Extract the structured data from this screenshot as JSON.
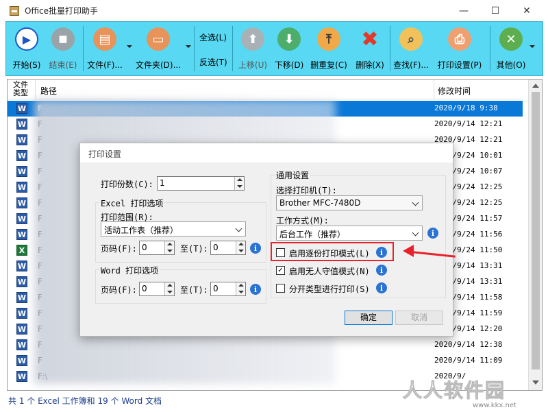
{
  "window": {
    "title": "Office批量打印助手",
    "minimize": "—",
    "maximize": "☐",
    "close": "✕"
  },
  "toolbar": {
    "start": "开始(S)",
    "end": "结束(E)",
    "file": "文件(F)...",
    "folder": "文件夹(D)...",
    "select_all": "全选(L)",
    "invert": "反选(T)",
    "move_up": "上移(U)",
    "move_down": "下移(D)",
    "dedupe": "删重复(C)",
    "delete": "删除(X)",
    "find": "查找(F)...",
    "print_settings": "打印设置(P)",
    "other": "其他(O)"
  },
  "list": {
    "col_type": "文件类型",
    "col_path": "路径",
    "col_time": "修改时间",
    "rows": [
      {
        "type": "word",
        "path": "F",
        "time": "2020/9/18  9:38",
        "selected": true
      },
      {
        "type": "word",
        "path": "F",
        "time": "2020/9/14 12:21"
      },
      {
        "type": "word",
        "path": "F",
        "time": "2020/9/14 12:21"
      },
      {
        "type": "word",
        "path": "F",
        "time": "2020/9/24 10:01"
      },
      {
        "type": "word",
        "path": "F",
        "time": "2020/9/24 10:07"
      },
      {
        "type": "word",
        "path": "F",
        "time": "2020/9/24 12:25"
      },
      {
        "type": "word",
        "path": "F",
        "time": "2020/9/24 12:25"
      },
      {
        "type": "word",
        "path": "F",
        "time": "2020/9/24 11:57"
      },
      {
        "type": "word",
        "path": "F",
        "time": "2020/9/24 11:56"
      },
      {
        "type": "excel",
        "path": "F",
        "time": "2020/9/24 11:50"
      },
      {
        "type": "word",
        "path": "F",
        "time": "2020/9/14 13:31"
      },
      {
        "type": "word",
        "path": "F",
        "time": "2020/9/14 13:31"
      },
      {
        "type": "word",
        "path": "F",
        "time": "2020/9/14 11:58"
      },
      {
        "type": "word",
        "path": "F",
        "time": "2020/9/14 11:59"
      },
      {
        "type": "word",
        "path": "F",
        "time": "2020/9/14 12:20"
      },
      {
        "type": "word",
        "path": "F",
        "time": "2020/9/14 12:38"
      },
      {
        "type": "word",
        "path": "F",
        "time": "2020/9/14 11:09"
      },
      {
        "type": "word",
        "path": "F:\\",
        "time": "2020/9/"
      }
    ]
  },
  "status": "共 1 个 Excel 工作簿和 19 个 Word 文档",
  "dialog": {
    "title": "打印设置",
    "copies_label": "打印份数(C):",
    "copies_value": "1",
    "excel_group": "Excel 打印选项",
    "print_range_label": "打印范围(R):",
    "print_range_value": "活动工作表（推荐）",
    "pages_label": "页码(F):",
    "from_value": "0",
    "to_label": "至(T):",
    "to_value": "0",
    "word_group": "Word 打印选项",
    "word_pages_label": "页码(F):",
    "word_from_value": "0",
    "word_to_label": "至(T):",
    "word_to_value": "0",
    "general_group": "通用设置",
    "printer_label": "选择打印机(T):",
    "printer_value": "Brother MFC-7480D",
    "mode_label": "工作方式(M):",
    "mode_value": "后台工作（推荐）",
    "collate_label": "启用逐份打印模式(L)",
    "collate_checked": false,
    "unattended_label": "启用无人守值模式(N)",
    "unattended_checked": true,
    "split_label": "分开类型进行打印(S)",
    "split_checked": false,
    "ok": "确定",
    "cancel": "取消"
  },
  "watermark": {
    "text": "人人软件园",
    "url": "www.kkx.net"
  }
}
